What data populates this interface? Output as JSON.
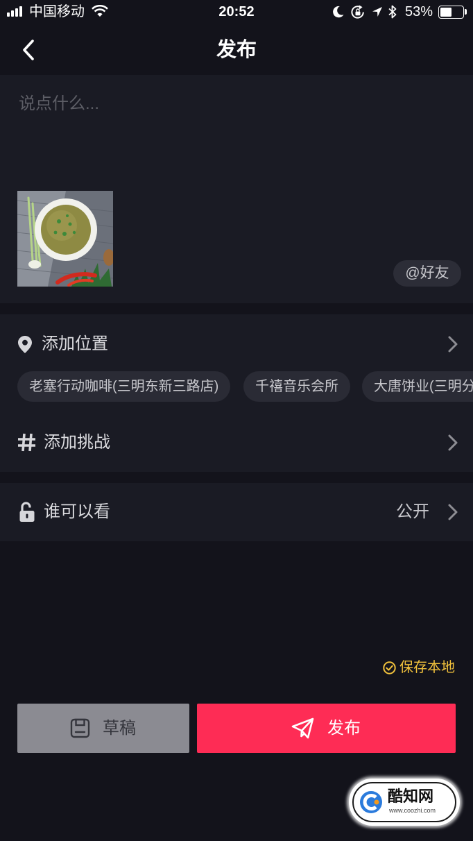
{
  "status_bar": {
    "carrier": "中国移动",
    "time": "20:52",
    "battery_label": "53%",
    "battery_level": 53,
    "icons": [
      "signal-icon",
      "wifi-icon",
      "moon-icon",
      "rotation-lock-icon",
      "location-arrow-icon",
      "bluetooth-icon",
      "battery-icon"
    ]
  },
  "header": {
    "title": "发布",
    "back_icon": "chevron-left-icon"
  },
  "compose": {
    "placeholder": "说点什么...",
    "mention_label": "@好友"
  },
  "location": {
    "label": "添加位置",
    "icon": "location-pin-icon",
    "suggestions": [
      "老塞行动咖啡(三明东新三路店)",
      "千禧音乐会所",
      "大唐饼业(三明分"
    ]
  },
  "challenge": {
    "label": "添加挑战",
    "icon": "hash-icon"
  },
  "privacy": {
    "label": "谁可以看",
    "value": "公开",
    "icon": "unlock-icon"
  },
  "save_local": {
    "label": "保存本地",
    "checked": true,
    "icon": "check-circle-icon",
    "color": "#f2c23c"
  },
  "actions": {
    "draft_label": "草稿",
    "draft_icon": "draft-icon",
    "draft_color": "#8b8b92",
    "publish_label": "发布",
    "publish_icon": "paper-plane-icon",
    "publish_color": "#fe2c55"
  },
  "watermark": {
    "name": "酷知网",
    "url": "www.coozhi.com"
  },
  "colors": {
    "background": "#13131b",
    "section": "#1a1b24",
    "chip": "#2a2b35"
  }
}
